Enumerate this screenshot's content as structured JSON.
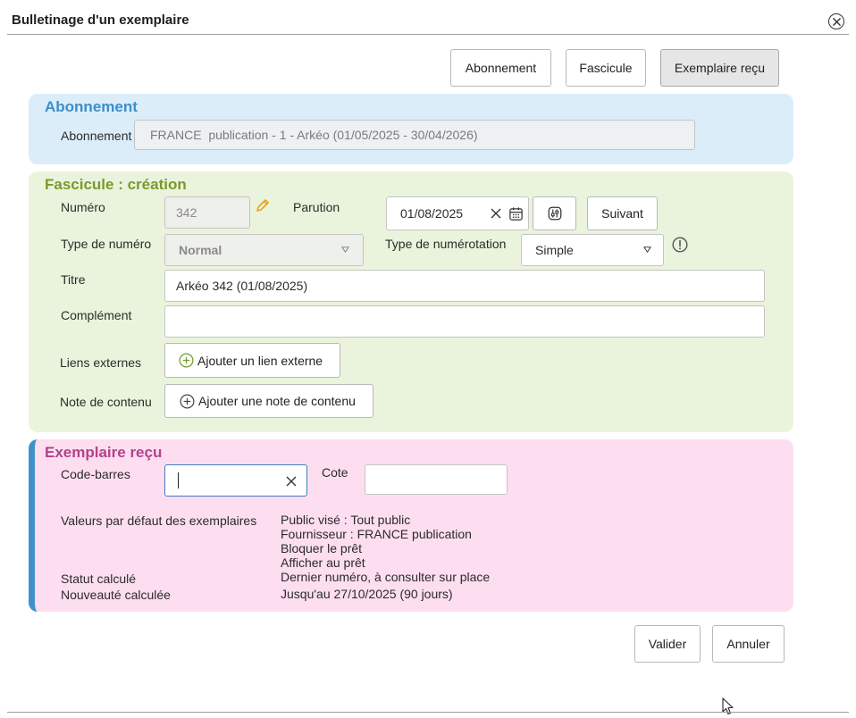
{
  "dialog": {
    "title": "Bulletinage d'un exemplaire",
    "close_icon": "close-circle-icon"
  },
  "toolbar": {
    "abonnement_label": "Abonnement",
    "fascicule_label": "Fascicule",
    "exemplaire_label": "Exemplaire reçu",
    "active": "Exemplaire reçu"
  },
  "abonnement": {
    "section_title": "Abonnement",
    "label": "Abonnement",
    "value": "FRANCE  publication - 1 - Arkéo (01/05/2025 - 30/04/2026)"
  },
  "fascicule": {
    "section_title": "Fascicule : création",
    "numero_label": "Numéro",
    "numero_value": "342",
    "parution_label": "Parution",
    "parution_value": "01/08/2025",
    "suivant_label": "Suivant",
    "type_numero_label": "Type de numéro",
    "type_numero_value": "Normal",
    "type_numerotation_label": "Type de numérotation",
    "type_numerotation_value": "Simple",
    "titre_label": "Titre",
    "titre_value": "Arkéo 342 (01/08/2025)",
    "complement_label": "Complément",
    "complement_value": "",
    "liens_label": "Liens externes",
    "liens_button": "Ajouter un lien externe",
    "note_label": "Note de contenu",
    "note_button": "Ajouter une note de contenu"
  },
  "exemplaire": {
    "section_title": "Exemplaire reçu",
    "codebarres_label": "Code-barres",
    "codebarres_value": "",
    "cote_label": "Cote",
    "cote_value": "",
    "defaults_label": "Valeurs par défaut des exemplaires",
    "defaults": [
      "Public visé : Tout public",
      "Fournisseur : FRANCE publication",
      "Bloquer le prêt",
      "Afficher au prêt"
    ],
    "statut_label": "Statut calculé",
    "statut_value": "Dernier numéro, à consulter sur place",
    "nouveaute_label": "Nouveauté calculée",
    "nouveaute_value": "Jusqu'au 27/10/2025 (90 jours)"
  },
  "footer": {
    "valider_label": "Valider",
    "annuler_label": "Annuler"
  },
  "colors": {
    "abonnement_accent": "#3b8ecb",
    "fascicule_accent": "#7a9a2b",
    "exemplaire_accent": "#b5418a",
    "pencil": "#e8a317"
  }
}
